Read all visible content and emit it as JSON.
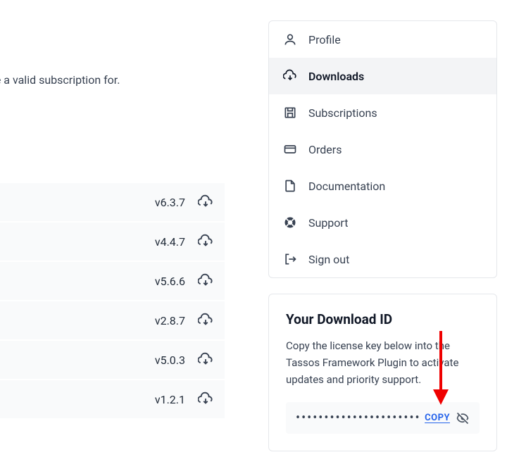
{
  "intro": {
    "text": "u have a valid subscription for."
  },
  "downloads": [
    {
      "version": "v6.3.7"
    },
    {
      "version": "v4.4.7"
    },
    {
      "version": "v5.6.6"
    },
    {
      "version": "v2.8.7"
    },
    {
      "version": "v5.0.3"
    },
    {
      "version": "v1.2.1"
    }
  ],
  "sidebar": {
    "items": [
      {
        "label": "Profile"
      },
      {
        "label": "Downloads"
      },
      {
        "label": "Subscriptions"
      },
      {
        "label": "Orders"
      },
      {
        "label": "Documentation"
      },
      {
        "label": "Support"
      },
      {
        "label": "Sign out"
      }
    ]
  },
  "download_id": {
    "title": "Your Download ID",
    "description": "Copy the license key below into the Tassos Framework Plugin to activate updates and priority support.",
    "masked_value": "••••••••••••••••••••••••",
    "copy_label": "COPY"
  }
}
